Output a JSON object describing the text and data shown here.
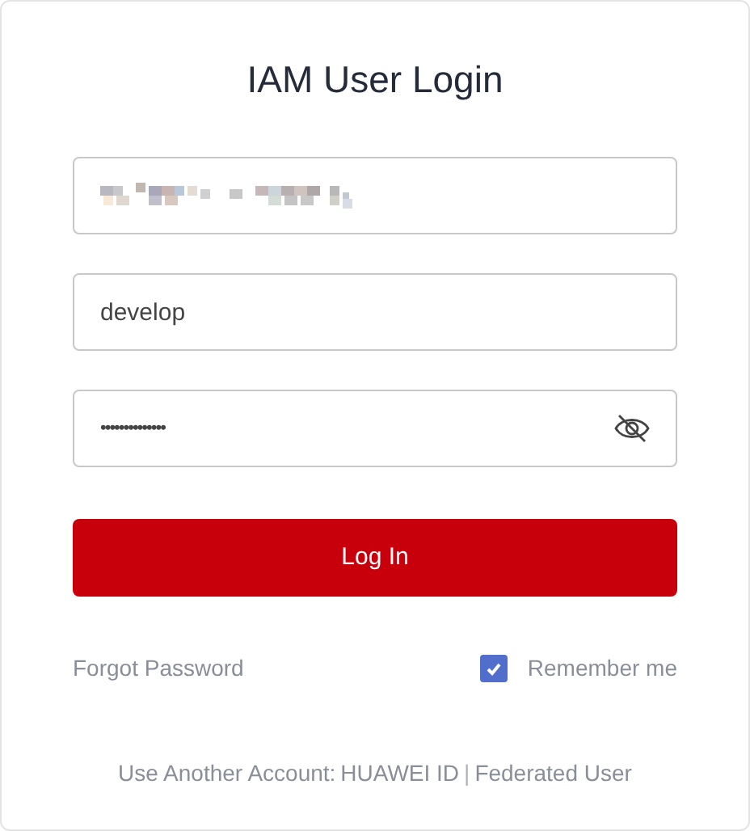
{
  "title": "IAM User Login",
  "fields": [
    {
      "kind": "redacted"
    },
    {
      "kind": "text",
      "value": "develop"
    },
    {
      "kind": "password",
      "value": "••••••••••••••",
      "revealed": false
    }
  ],
  "login_button": "Log In",
  "forgot_link": "Forgot Password",
  "remember": {
    "label": "Remember me",
    "checked": true
  },
  "footer": {
    "prefix": "Use Another Account:",
    "links": [
      "HUAWEI ID",
      "Federated User"
    ],
    "separator": "|"
  }
}
